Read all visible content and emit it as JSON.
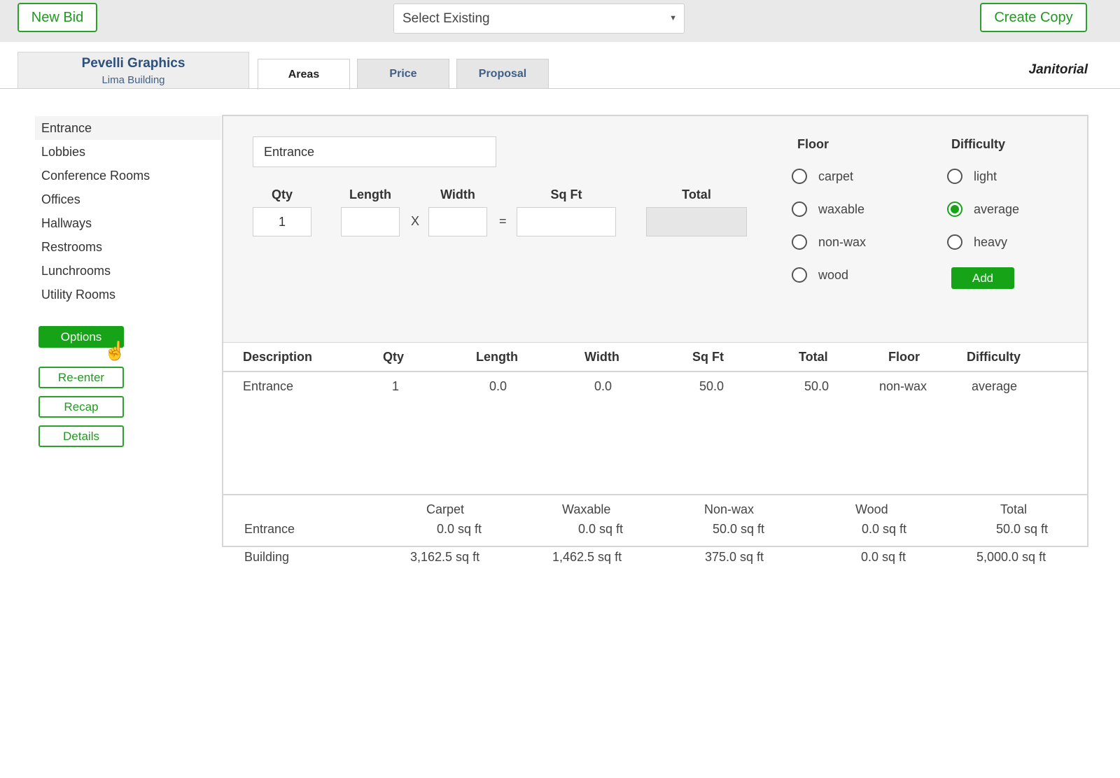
{
  "topbar": {
    "new_bid_label": "New Bid",
    "select_existing_value": "Select Existing",
    "create_copy_label": "Create Copy"
  },
  "client": {
    "name": "Pevelli Graphics",
    "building": "Lima Building"
  },
  "tabs": [
    {
      "label": "Areas",
      "active": true
    },
    {
      "label": "Price",
      "active": false
    },
    {
      "label": "Proposal",
      "active": false
    }
  ],
  "service_type": "Janitorial",
  "sidebar": {
    "items": [
      {
        "label": "Entrance",
        "active": true
      },
      {
        "label": "Lobbies"
      },
      {
        "label": "Conference Rooms"
      },
      {
        "label": "Offices"
      },
      {
        "label": "Hallways"
      },
      {
        "label": "Restrooms"
      },
      {
        "label": "Lunchrooms"
      },
      {
        "label": "Utility Rooms"
      }
    ],
    "buttons": {
      "options": "Options",
      "reenter": "Re-enter",
      "recap": "Recap",
      "details": "Details"
    }
  },
  "form": {
    "description_value": "Entrance",
    "labels": {
      "qty": "Qty",
      "length": "Length",
      "width": "Width",
      "sqft": "Sq Ft",
      "total": "Total"
    },
    "qty_value": "1",
    "length_value": "",
    "width_value": "",
    "sqft_value": "",
    "times_symbol": "X",
    "equals_symbol": "=",
    "floor": {
      "title": "Floor",
      "options": [
        "carpet",
        "waxable",
        "non-wax",
        "wood"
      ],
      "selected": null
    },
    "difficulty": {
      "title": "Difficulty",
      "options": [
        "light",
        "average",
        "heavy"
      ],
      "selected": "average"
    },
    "add_label": "Add"
  },
  "table": {
    "headers": [
      "Description",
      "Qty",
      "Length",
      "Width",
      "Sq Ft",
      "Total",
      "Floor",
      "Difficulty"
    ],
    "rows": [
      [
        "Entrance",
        "1",
        "0.0",
        "0.0",
        "50.0",
        "50.0",
        "non-wax",
        "average"
      ]
    ]
  },
  "summary": {
    "headers": [
      "Carpet",
      "Waxable",
      "Non-wax",
      "Wood",
      "Total"
    ],
    "area_label": "Entrance",
    "area_values": [
      "0.0 sq ft",
      "0.0 sq ft",
      "50.0 sq ft",
      "0.0 sq ft",
      "50.0 sq ft"
    ],
    "building_label": "Building",
    "building_values": [
      "3,162.5 sq ft",
      "1,462.5 sq ft",
      "375.0 sq ft",
      "0.0 sq ft",
      "5,000.0 sq ft"
    ]
  },
  "colors": {
    "accent_green": "#17a317",
    "link_blue": "#2c4f7c"
  },
  "icons": {
    "dropdown": "chevron-down-icon",
    "cursor": "hand-pointer-icon"
  }
}
